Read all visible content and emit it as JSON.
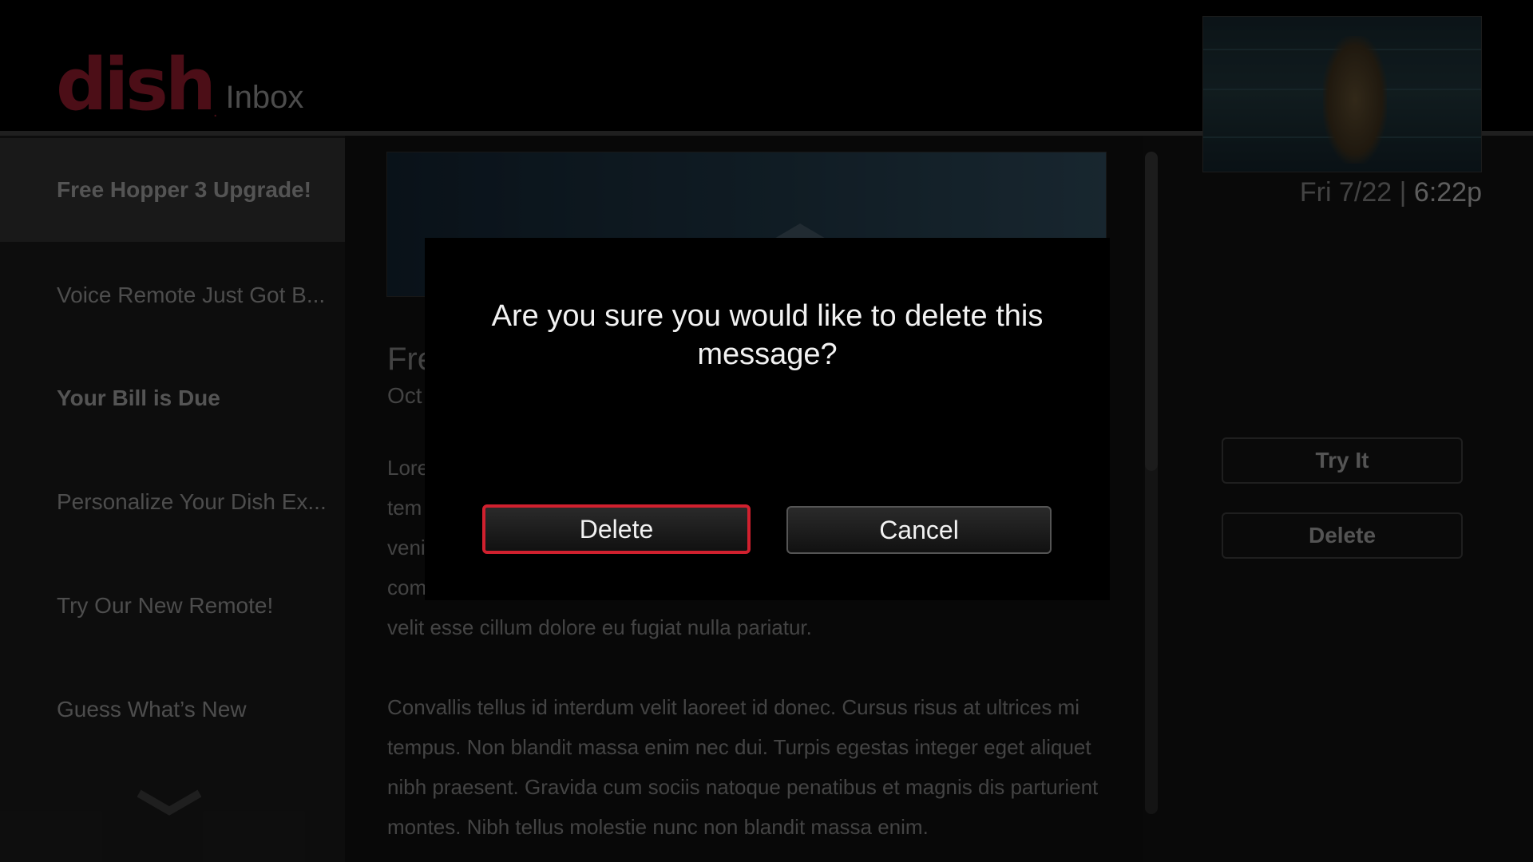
{
  "header": {
    "logo_text": "dish",
    "title": "Inbox"
  },
  "sidebar": {
    "items": [
      {
        "label": "Free Hopper 3 Upgrade!",
        "selected": true,
        "unread": true
      },
      {
        "label": "Voice Remote Just Got B...",
        "selected": false,
        "unread": false
      },
      {
        "label": "Your Bill is Due",
        "selected": false,
        "unread": true
      },
      {
        "label": "Personalize Your Dish Ex...",
        "selected": false,
        "unread": false
      },
      {
        "label": "Try Our New Remote!",
        "selected": false,
        "unread": false
      },
      {
        "label": "Guess What’s New",
        "selected": false,
        "unread": false
      }
    ]
  },
  "message": {
    "title_partial": "Fre",
    "date_partial": "Oct",
    "para1_lines": [
      "Lore",
      "tem",
      "veni",
      "com",
      "velit esse cillum dolore eu fugiat nulla pariatur."
    ],
    "para2": "Convallis tellus id interdum velit laoreet id donec. Cursus risus at ultrices mi tempus. Non blandit massa enim nec dui. Turpis egestas integer eget aliquet nibh praesent. Gravida cum sociis natoque penatibus et magnis dis parturient montes. Nibh tellus molestie nunc non blandit massa enim."
  },
  "status": {
    "date": "Fri 7/22",
    "separator": "|",
    "time": "6:22p"
  },
  "actions": {
    "try_label": "Try It",
    "delete_label": "Delete"
  },
  "dialog": {
    "message": "Are you sure you would like to delete this message?",
    "confirm_label": "Delete",
    "cancel_label": "Cancel",
    "focused": "confirm"
  },
  "colors": {
    "brand": "#8b1a2a",
    "focus": "#d0202e"
  }
}
